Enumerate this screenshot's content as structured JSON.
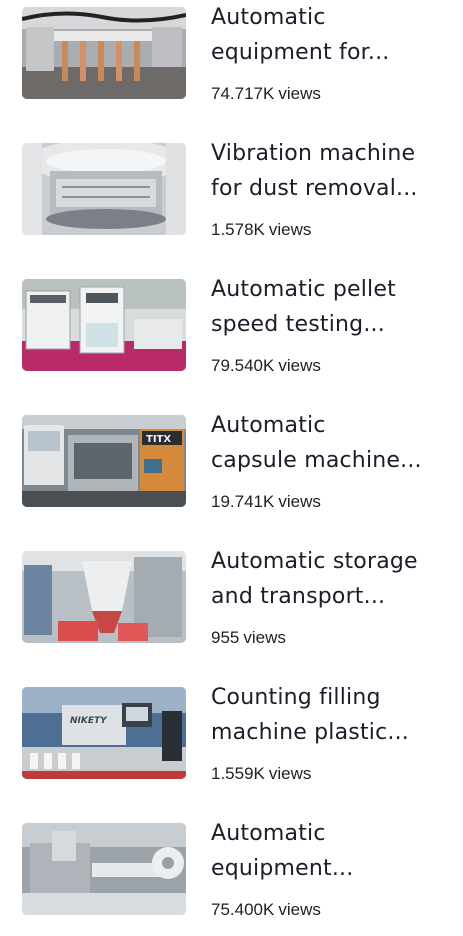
{
  "videos": [
    {
      "title_line1": "Automatic",
      "title_line2": "equipment for...",
      "views": "74.717K",
      "views_suffix": "views"
    },
    {
      "title_line1": "Vibration machine",
      "title_line2": "for dust removal...",
      "views": "1.578K",
      "views_suffix": "views"
    },
    {
      "title_line1": "Automatic pellet",
      "title_line2": "speed testing...",
      "views": "79.540K",
      "views_suffix": "views"
    },
    {
      "title_line1": "Automatic",
      "title_line2": "capsule machine...",
      "views": "19.741K",
      "views_suffix": "views"
    },
    {
      "title_line1": "Automatic storage",
      "title_line2": "and transport...",
      "views": "955",
      "views_suffix": "views"
    },
    {
      "title_line1": "Counting filling",
      "title_line2": "machine plastic...",
      "views": "1.559K",
      "views_suffix": "views"
    },
    {
      "title_line1": "Automatic",
      "title_line2": "equipment...",
      "views": "75.400K",
      "views_suffix": "views"
    }
  ],
  "thumbnail_text": {
    "capsule_brand": "TITX",
    "filling_brand": "NIKETY"
  }
}
